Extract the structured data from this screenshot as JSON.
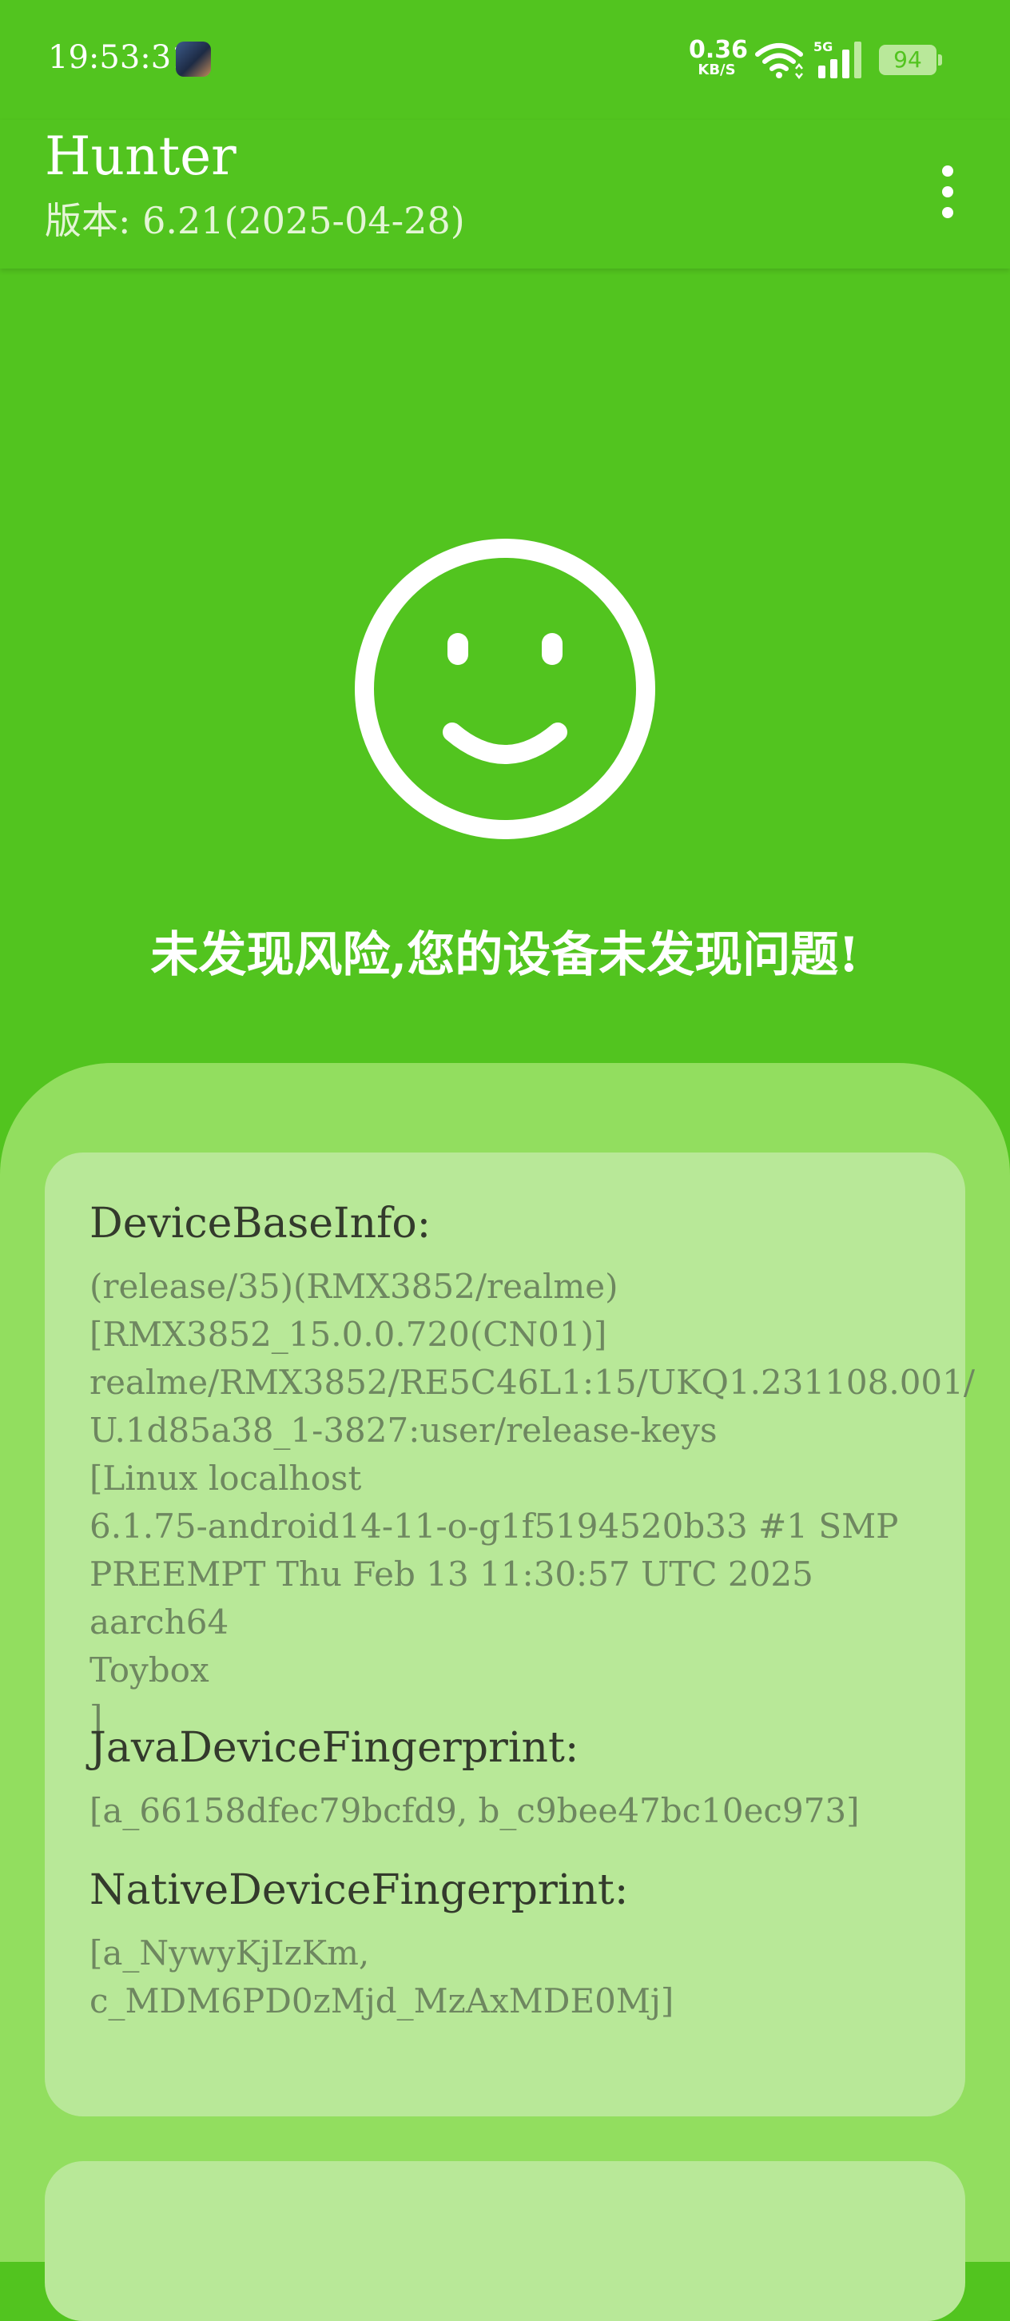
{
  "status_bar": {
    "time": "19:53:31",
    "net_speed_value": "0.36",
    "net_speed_unit": "KB/S",
    "network_type": "5G",
    "battery": "94"
  },
  "app_bar": {
    "title": "Hunter",
    "version": "版本: 6.21(2025-04-28)",
    "menu_icon": "more-vert-icon"
  },
  "result": {
    "icon": "smiley-icon",
    "message": "未发现风险,您的设备未发现问题!"
  },
  "device_info": {
    "sections": [
      {
        "title": "DeviceBaseInfo:",
        "body": "(release/35)(RMX3852/realme)\n[RMX3852_15.0.0.720(CN01)]\nrealme/RMX3852/RE5C46L1:15/UKQ1.231108.001/\nU.1d85a38_1-3827:user/release-keys\n[Linux localhost\n6.1.75-android14-11-o-g1f5194520b33 #1 SMP\nPREEMPT Thu Feb 13 11:30:57 UTC 2025 aarch64\nToybox\n]"
      },
      {
        "title": "JavaDeviceFingerprint:",
        "body": "[a_66158dfec79bcfd9, b_c9bee47bc10ec973]"
      },
      {
        "title": "NativeDeviceFingerprint:",
        "body": "[a_NywyKjIzKm,\nc_MDM6PD0zMjd_MzAxMDE0Mj]"
      }
    ]
  },
  "colors": {
    "primary": "#52c41f",
    "sheet": "#92de5f",
    "card": "#b8e898"
  }
}
